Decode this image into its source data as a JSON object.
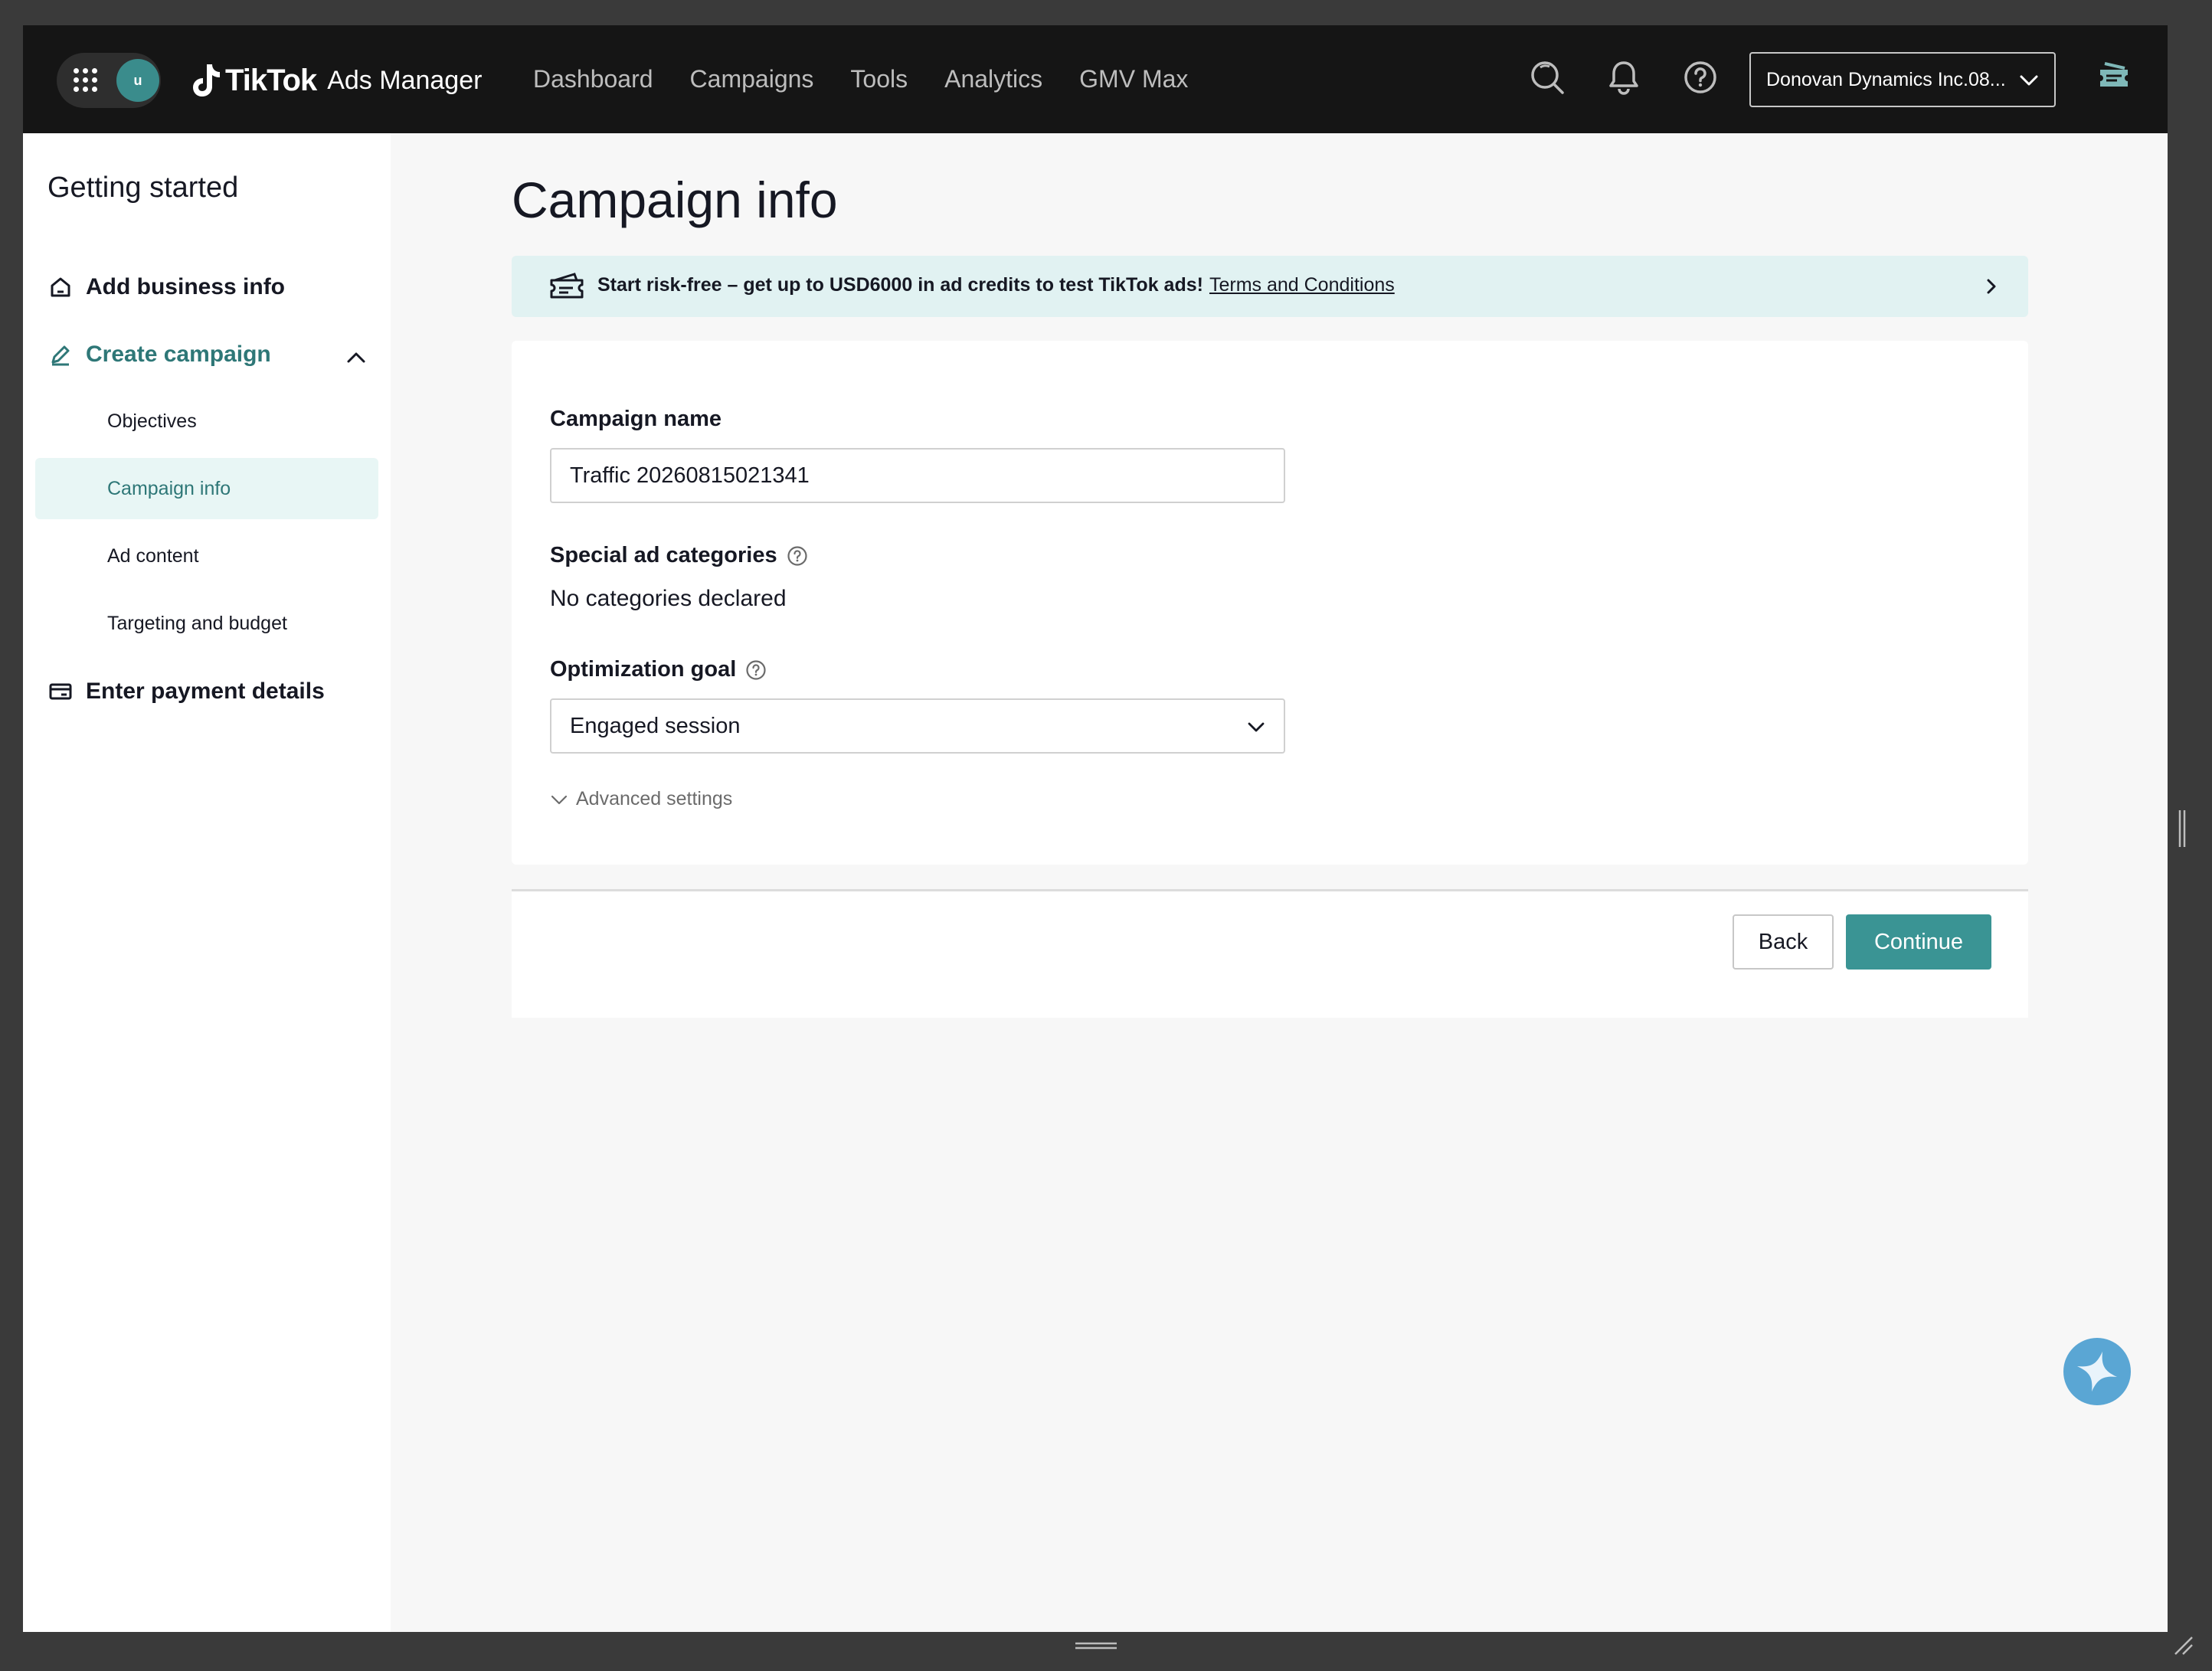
{
  "header": {
    "avatar_initial": "u",
    "brand_name": "TikTok",
    "brand_product": "Ads Manager",
    "nav": [
      "Dashboard",
      "Campaigns",
      "Tools",
      "Analytics",
      "GMV Max"
    ],
    "account_name": "Donovan Dynamics Inc.08..."
  },
  "sidebar": {
    "title": "Getting started",
    "add_business": "Add business info",
    "create_campaign": "Create campaign",
    "sub_items": [
      "Objectives",
      "Campaign info",
      "Ad content",
      "Targeting and budget"
    ],
    "payment": "Enter payment details",
    "selected_sub": "Campaign info"
  },
  "main": {
    "title": "Campaign info",
    "banner": {
      "text": "Start risk-free – get up to USD6000 in ad credits to test TikTok ads!",
      "link": "Terms and Conditions"
    },
    "campaign_name_label": "Campaign name",
    "campaign_name_value": "Traffic 20260815021341",
    "special_ad_label": "Special ad categories",
    "special_ad_value": "No categories declared",
    "optimization_label": "Optimization goal",
    "optimization_value": "Engaged session",
    "advanced_settings": "Advanced settings",
    "back_label": "Back",
    "continue_label": "Continue"
  },
  "colors": {
    "accent": "#3a9494",
    "accent_text": "#2e7777",
    "banner_bg": "#e1f2f2",
    "topbar_bg": "#151515"
  }
}
